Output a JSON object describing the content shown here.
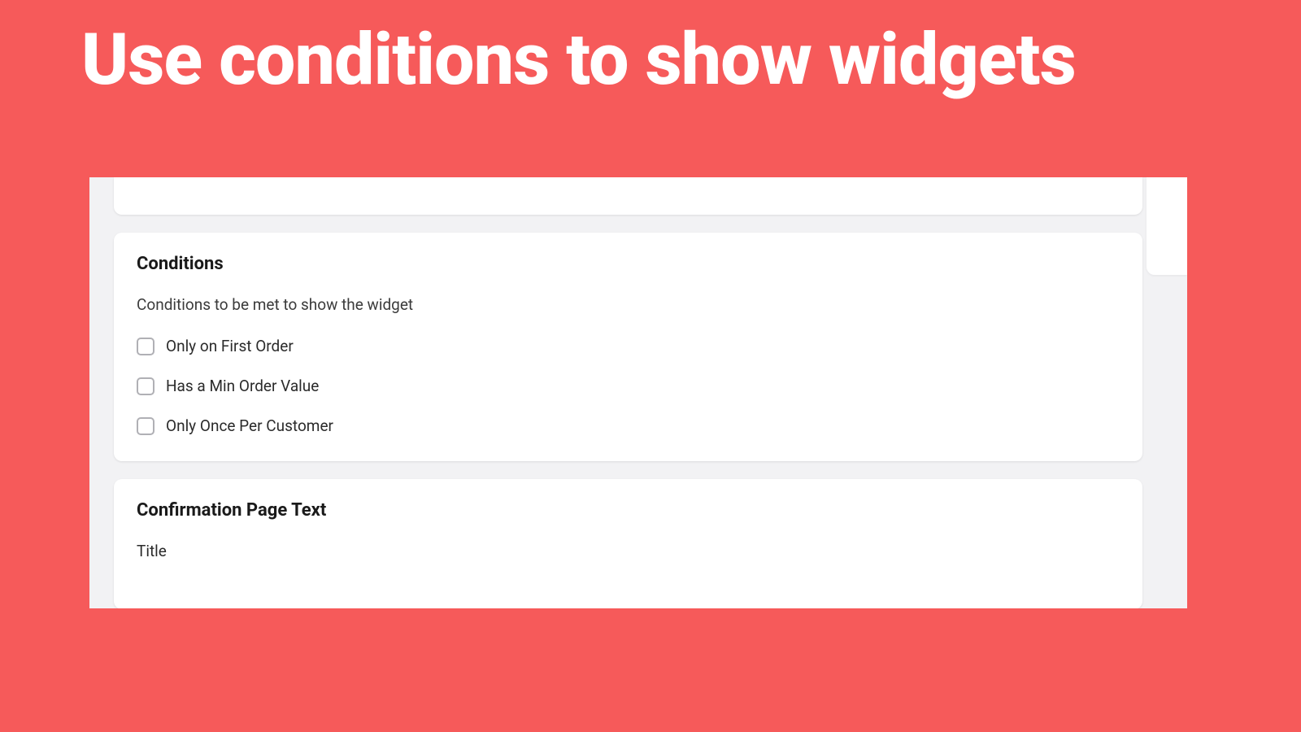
{
  "hero": {
    "title": "Use conditions to show widgets"
  },
  "conditions_card": {
    "heading": "Conditions",
    "description": "Conditions to be met to show the widget",
    "options": [
      {
        "label": "Only on First Order"
      },
      {
        "label": "Has a Min Order Value"
      },
      {
        "label": "Only Once Per Customer"
      }
    ]
  },
  "confirmation_card": {
    "heading": "Confirmation Page Text",
    "title_field_label": "Title"
  }
}
